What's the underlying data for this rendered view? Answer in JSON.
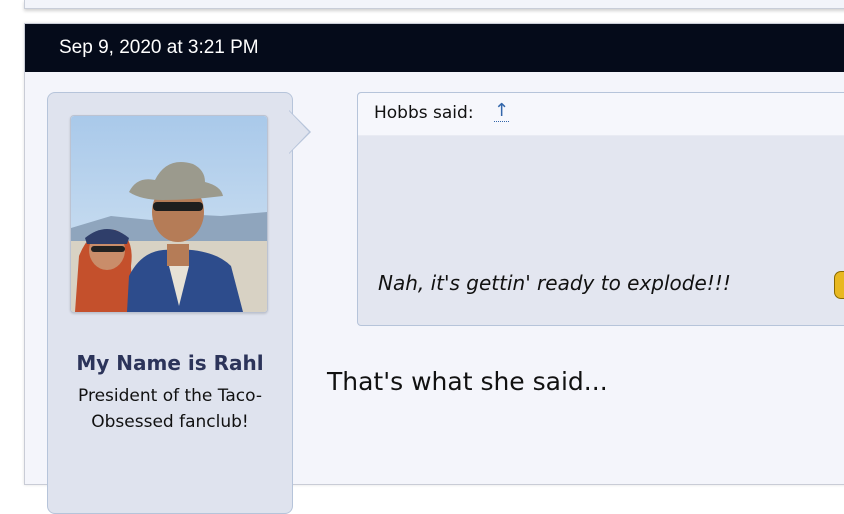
{
  "post": {
    "date": "Sep 9, 2020 at 3:21 PM",
    "message": "That's what she said..."
  },
  "user": {
    "name": "My Name is Rahl",
    "title_line1": "President of the Taco-",
    "title_line2": "Obsessed fanclub!",
    "avatar_icon": "avatar-photo"
  },
  "quote": {
    "author": "Hobbs said:",
    "link_glyph": "↑",
    "text": "Nah, it's gettin' ready to explode!!!",
    "smiley_icon": "smiley-icon"
  },
  "colors": {
    "header_bg": "#050b1a",
    "username": "#2c345a",
    "link": "#3366aa",
    "panel_bg": "#dfe3ee"
  }
}
